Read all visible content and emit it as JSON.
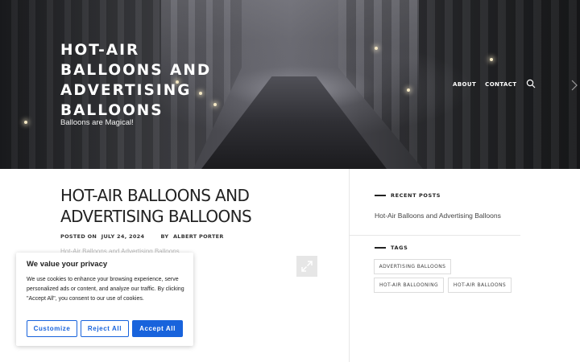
{
  "site": {
    "title": "HOT-AIR BALLOONS AND ADVERTISING BALLOONS",
    "tagline": "Balloons are Magical!"
  },
  "nav": {
    "items": [
      {
        "label": "ABOUT"
      },
      {
        "label": "CONTACT"
      }
    ],
    "search_icon": "search-icon"
  },
  "post": {
    "title": "HOT-AIR BALLOONS AND ADVERTISING BALLOONS",
    "meta": {
      "posted_prefix": "POSTED ON",
      "date": "JULY 24, 2024",
      "by_prefix": "BY",
      "author": "ALBERT PORTER"
    },
    "image_alt": "Hot-Air Balloons and Advertising Balloons",
    "expand_icon": "expand-icon"
  },
  "sidebar": {
    "recent_posts": {
      "title": "RECENT POSTS",
      "items": [
        {
          "label": "Hot-Air Balloons and Advertising Balloons"
        }
      ]
    },
    "tags": {
      "title": "TAGS",
      "items": [
        {
          "label": "ADVERTISING BALLOONS"
        },
        {
          "label": "HOT-AIR BALLOONING"
        },
        {
          "label": "HOT-AIR BALLOONS"
        }
      ]
    }
  },
  "cookie_banner": {
    "title": "We value your privacy",
    "text": "We use cookies to enhance your browsing experience, serve personalized ads or content, and analyze our traffic. By clicking \"Accept All\", you consent to our use of cookies.",
    "buttons": {
      "customize": "Customize",
      "reject": "Reject All",
      "accept": "Accept All"
    },
    "accent_color": "#1863dc"
  }
}
